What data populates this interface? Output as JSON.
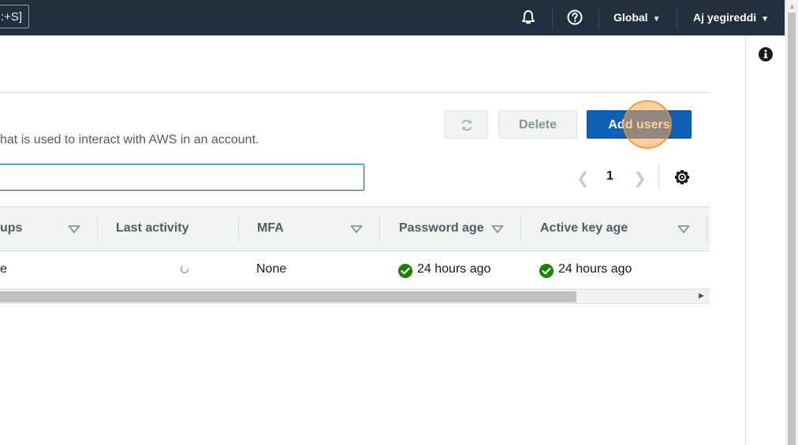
{
  "topnav": {
    "shortcut_hint": "[Alt+S]",
    "shortcut_visible": ":+S]",
    "region_label": "Global",
    "user_label": "Aj yegireddi",
    "icons": [
      "bell-icon",
      "help-icon"
    ]
  },
  "users_panel": {
    "description": "hat is used to interact with AWS in an account.",
    "buttons": {
      "refresh_icon": "refresh-icon",
      "delete_label": "Delete",
      "add_users_label": "Add users"
    },
    "search": {
      "value": "",
      "placeholder": ""
    },
    "pagination": {
      "current_page": "1"
    }
  },
  "table": {
    "columns": [
      {
        "label": "ups",
        "sortable": true
      },
      {
        "label": "Last activity",
        "sortable": false
      },
      {
        "label": "MFA",
        "sortable": true
      },
      {
        "label": "Password age",
        "sortable": true
      },
      {
        "label": "Active key age",
        "sortable": true
      }
    ],
    "rows": [
      {
        "groups": "e",
        "last_activity": "",
        "mfa": "None",
        "password_age": "24 hours ago",
        "active_key_age": "24 hours ago"
      }
    ]
  },
  "colors": {
    "nav_bg": "#232f3e",
    "primary": "#0d62b8",
    "success": "#1d8102"
  }
}
